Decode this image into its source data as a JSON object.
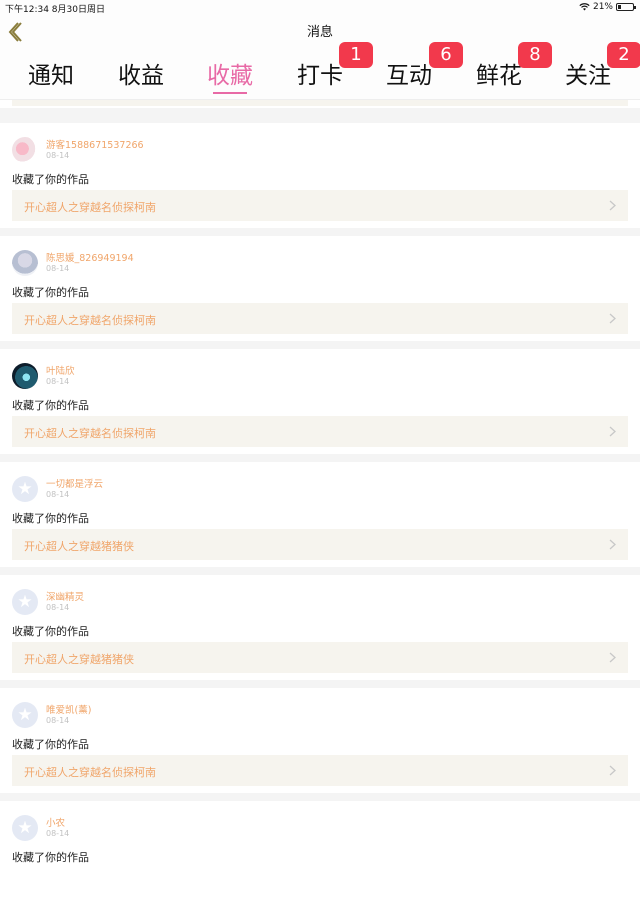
{
  "status_bar": {
    "time_date": "下午12:34   8月30日周日",
    "battery": "21%"
  },
  "nav": {
    "title": "消息"
  },
  "tabs": [
    {
      "label": "通知"
    },
    {
      "label": "收益"
    },
    {
      "label": "收藏",
      "active": true
    },
    {
      "label": "打卡",
      "badge": "1"
    },
    {
      "label": "互动",
      "badge": "6"
    },
    {
      "label": "鲜花",
      "badge": "8"
    },
    {
      "label": "关注",
      "badge": "2"
    }
  ],
  "notifications": [
    {
      "username": "游客1588671537266",
      "date": "08-14",
      "action": "收藏了你的作品",
      "work": "开心超人之穿越名侦探柯南",
      "avatar": "flower-avatar"
    },
    {
      "username": "陈思媛_826949194",
      "date": "08-14",
      "action": "收藏了你的作品",
      "work": "开心超人之穿越名侦探柯南",
      "avatar": "girl-avatar"
    },
    {
      "username": "叶陆欣",
      "date": "08-14",
      "action": "收藏了你的作品",
      "work": "开心超人之穿越名侦探柯南",
      "avatar": "night-avatar"
    },
    {
      "username": "一切都是浮云",
      "date": "08-14",
      "action": "收藏了你的作品",
      "work": "开心超人之穿越猪猪侠",
      "avatar": "default-avatar"
    },
    {
      "username": "深幽精灵",
      "date": "08-14",
      "action": "收藏了你的作品",
      "work": "开心超人之穿越猪猪侠",
      "avatar": "default-avatar"
    },
    {
      "username": "唯爱凯(薰)",
      "date": "08-14",
      "action": "收藏了你的作品",
      "work": "开心超人之穿越名侦探柯南",
      "avatar": "default-avatar"
    },
    {
      "username": "小农",
      "date": "08-14",
      "action": "收藏了你的作品",
      "work": "",
      "avatar": "default-avatar"
    }
  ],
  "colors": {
    "accent": "#e86aa6",
    "badge": "#f2394c",
    "username": "#f0a56a",
    "link_bg": "#f6f4ee"
  }
}
